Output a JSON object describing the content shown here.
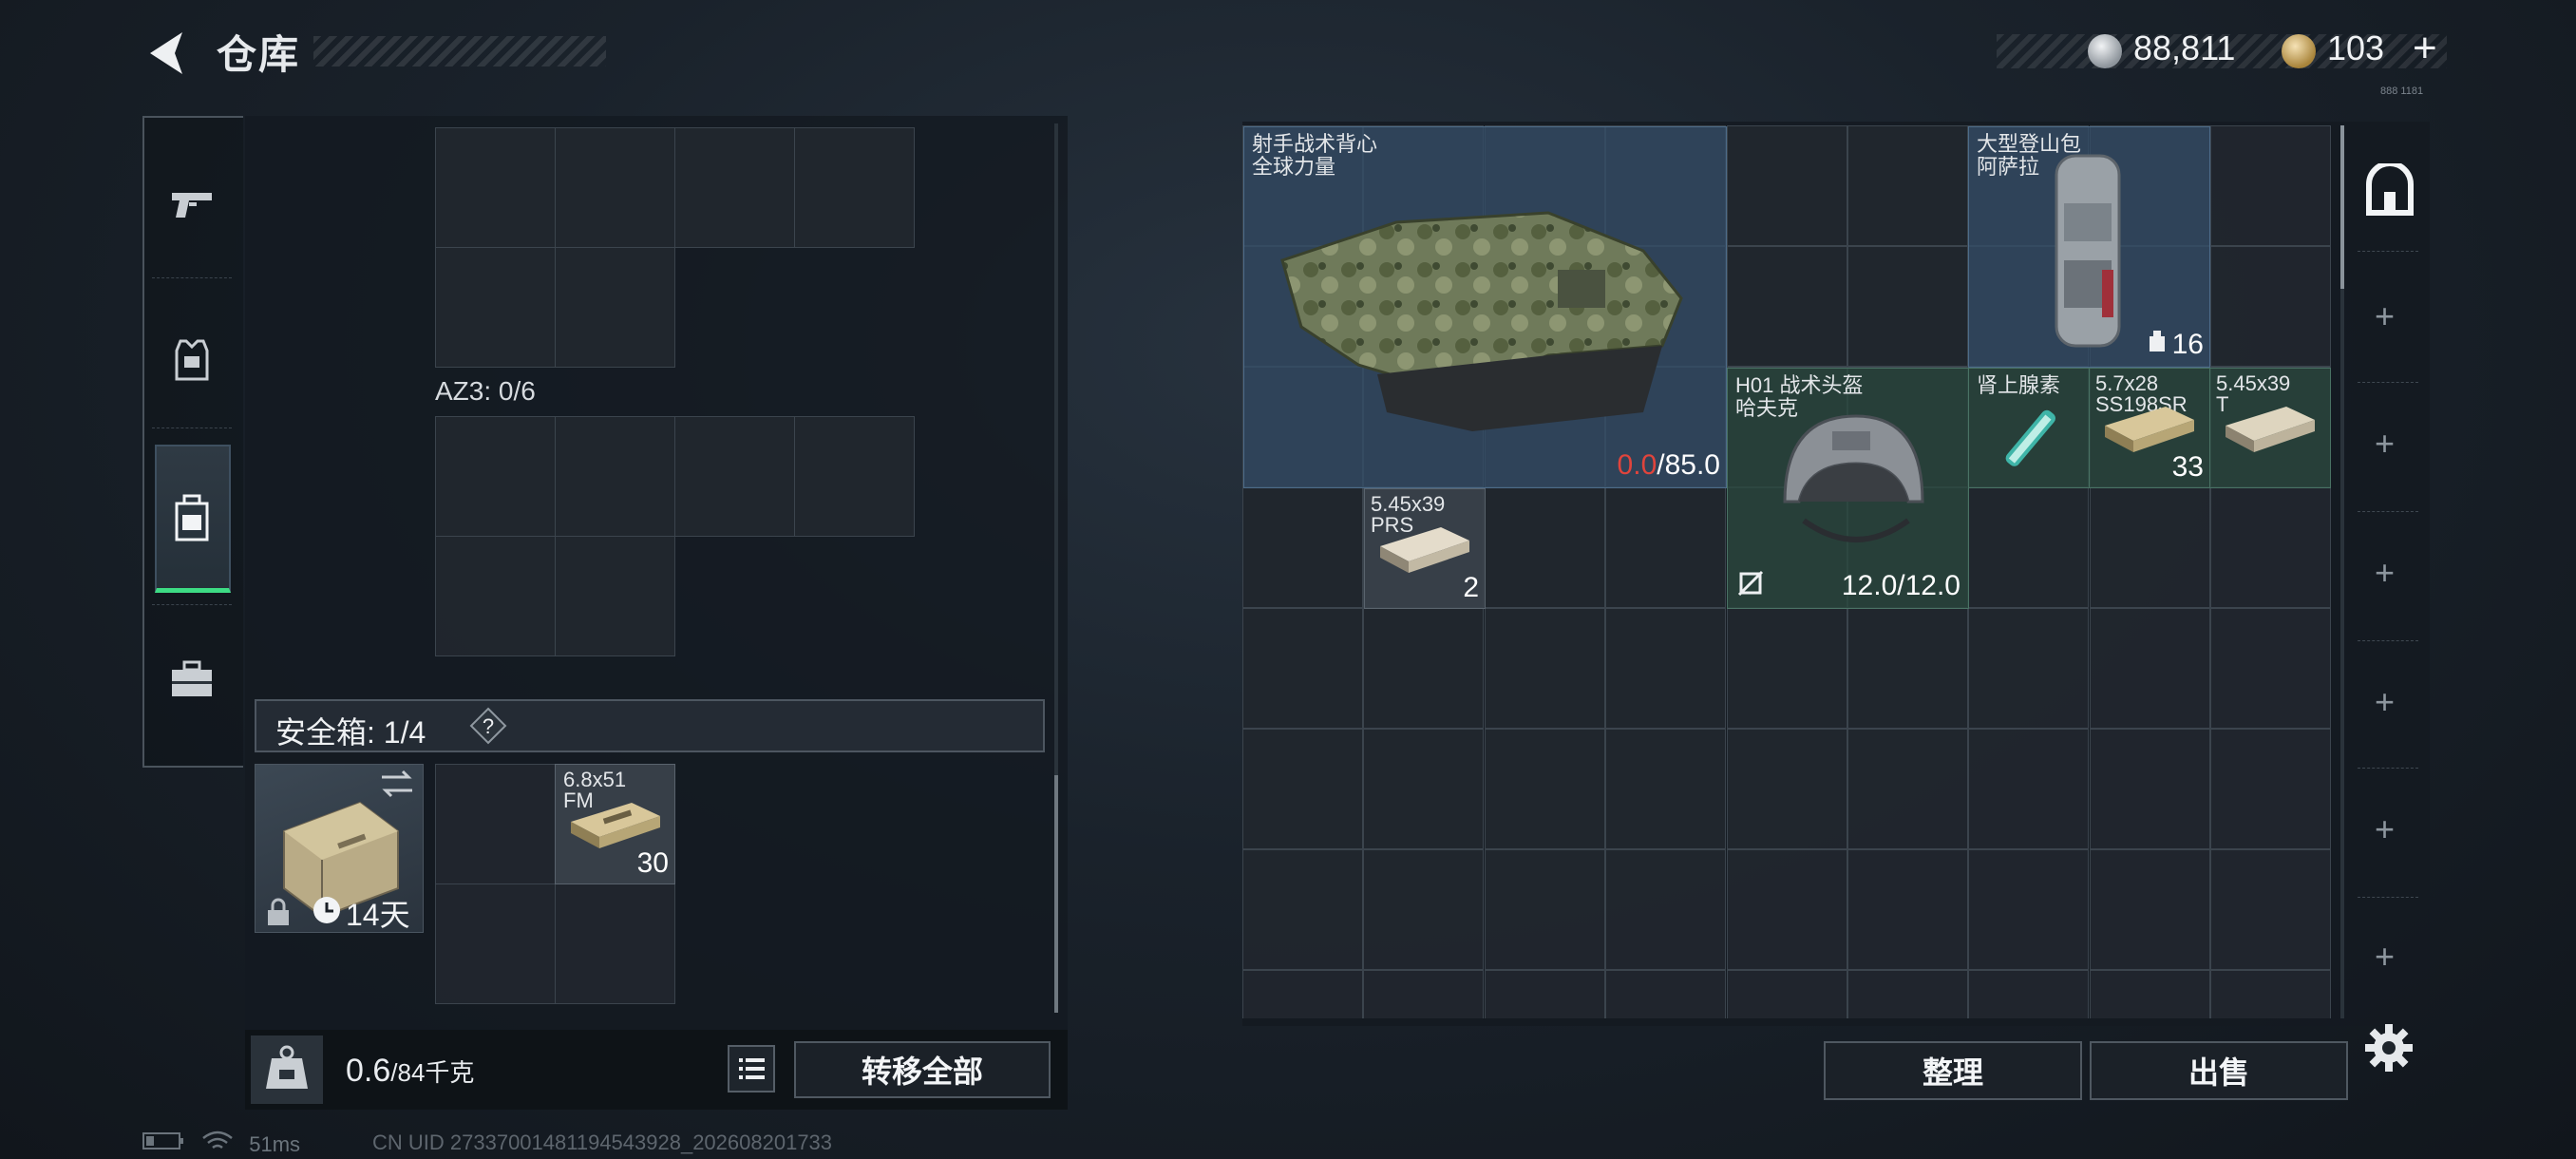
{
  "header": {
    "title": "仓库",
    "silver": "88,811",
    "gold": "103",
    "plus": "+",
    "tiny_text": "888 1181"
  },
  "colors": {
    "accent_green": "#3ddc84",
    "durability_red": "#e0443c"
  },
  "sidebar": {
    "categories": [
      {
        "name": "weapons",
        "icon": "pistol-icon"
      },
      {
        "name": "armor",
        "icon": "vest-icon"
      },
      {
        "name": "backpack",
        "icon": "backpack-icon",
        "active": true
      },
      {
        "name": "case",
        "icon": "toolbox-icon"
      }
    ]
  },
  "left": {
    "slot_label": "AZ3: 0/6",
    "safebox": {
      "label": "安全箱:",
      "count": "1/4",
      "help": "?",
      "days": "14天"
    },
    "safebox_item": {
      "name1": "6.8x51",
      "name2": "FM",
      "count": "30"
    },
    "weight": {
      "value": "0.6",
      "unit": "/84千克"
    },
    "transfer_all": "转移全部"
  },
  "right": {
    "items": {
      "vest": {
        "name1": "射手战术背心",
        "name2": "全球力量",
        "durability_current": "0.0",
        "durability_max": "/85.0"
      },
      "backpack": {
        "name1": "大型登山包",
        "name2": "阿萨拉",
        "count": "16"
      },
      "helmet": {
        "name1": "H01 战术头盔",
        "name2": "哈夫克",
        "durability": "12.0/12.0"
      },
      "adrenaline": {
        "name1": "肾上腺素"
      },
      "ammo_57": {
        "name1": "5.7x28",
        "name2": "SS198SR",
        "count": "33"
      },
      "ammo_545t": {
        "name1": "5.45x39",
        "name2": "T"
      },
      "ammo_545prs": {
        "name1": "5.45x39",
        "name2": "PRS",
        "count": "2"
      }
    },
    "sort": "整理",
    "sell": "出售"
  },
  "status": {
    "ping": "51ms",
    "uid": "CN UID 27337001481194543928_202608201733"
  }
}
